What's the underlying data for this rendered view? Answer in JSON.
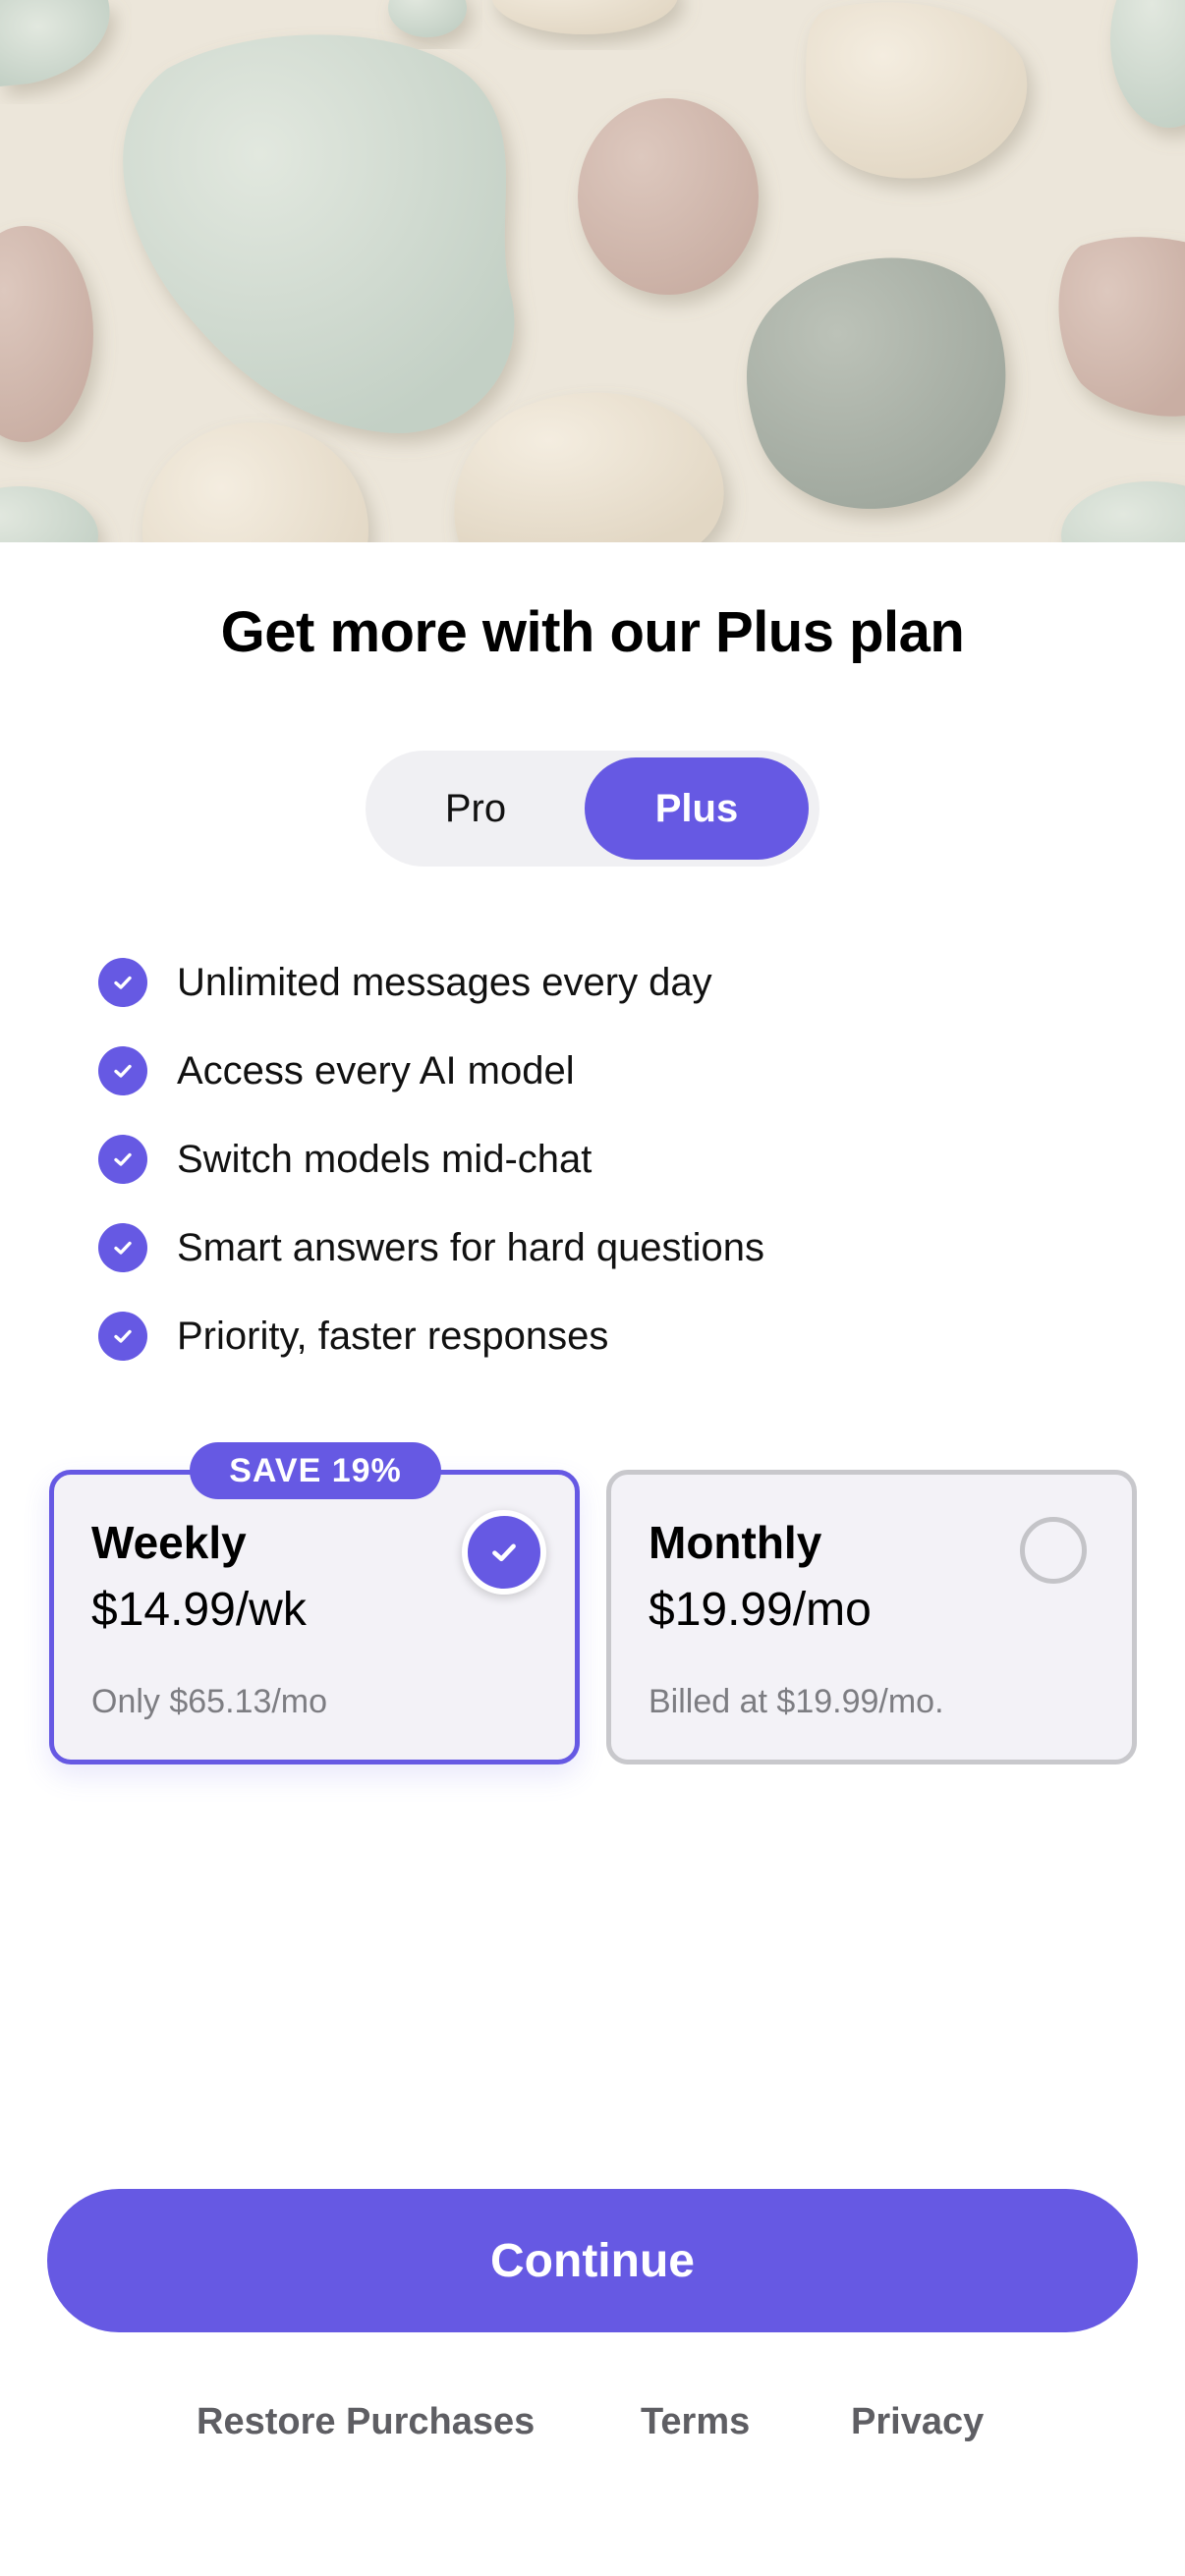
{
  "hero": {
    "image_name": "pastel-pebbles-artwork"
  },
  "title": "Get more with our Plus plan",
  "plan_toggle": {
    "options": [
      "Pro",
      "Plus"
    ],
    "selected": "Plus"
  },
  "features": [
    {
      "label": "Unlimited messages every day",
      "icon": "check-circle-icon"
    },
    {
      "label": "Access every AI model",
      "icon": "check-circle-icon"
    },
    {
      "label": "Switch models mid-chat",
      "icon": "check-circle-icon"
    },
    {
      "label": "Smart answers for hard questions",
      "icon": "check-circle-icon"
    },
    {
      "label": "Priority, faster responses",
      "icon": "check-circle-icon"
    }
  ],
  "plans": {
    "weekly": {
      "badge": "SAVE 19%",
      "name": "Weekly",
      "price": "$14.99/wk",
      "note": "Only $65.13/mo",
      "selected": true
    },
    "monthly": {
      "name": "Monthly",
      "price": "$19.99/mo",
      "note": "Billed at $19.99/mo.",
      "selected": false
    }
  },
  "cta": {
    "label": "Continue"
  },
  "footer": {
    "restore": "Restore Purchases",
    "terms": "Terms",
    "privacy": "Privacy"
  },
  "colors": {
    "accent": "#6659e3",
    "toggle_bg": "#f0f0f3",
    "card_bg": "#f3f2f7",
    "muted_text": "#7d7d82",
    "footer_text": "#5e5e63"
  }
}
